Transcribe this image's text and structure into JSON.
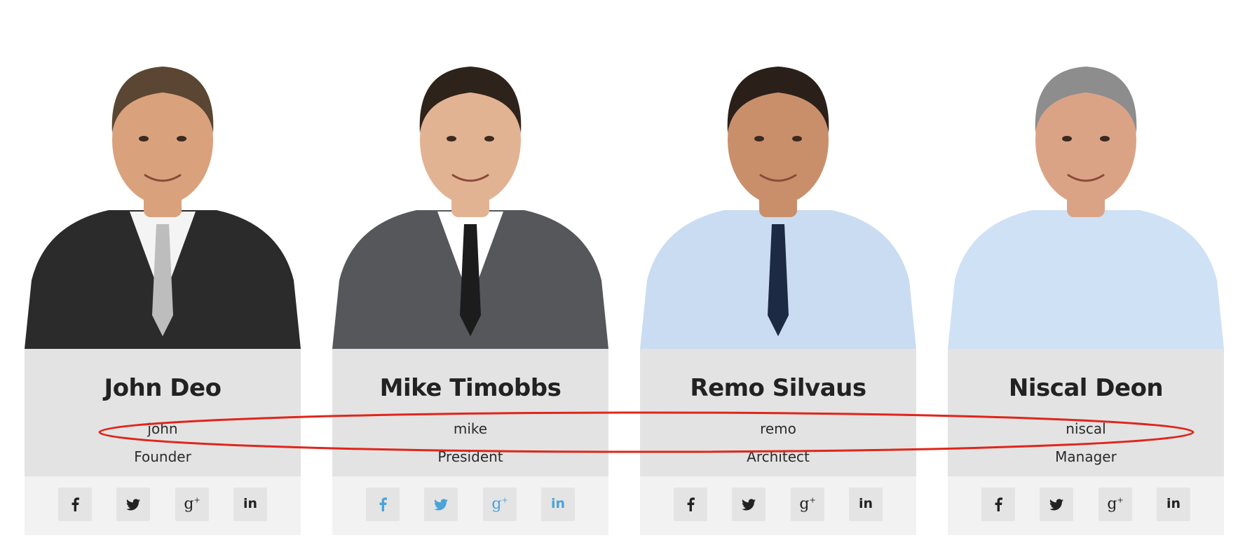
{
  "members": [
    {
      "name": "John Deo",
      "username": "john",
      "role": "Founder",
      "photo_icon": "person-photo",
      "suit": "#2b2b2b",
      "shirt": "#f4f4f4",
      "tie": "#bdbdbd",
      "hair": "#5a4632",
      "skin": "#d9a27c",
      "social_color": "#222222",
      "social": [
        "facebook-icon",
        "twitter-icon",
        "google-plus-icon",
        "linkedin-icon"
      ]
    },
    {
      "name": "Mike Timobbs",
      "username": "mike",
      "role": "President",
      "photo_icon": "person-photo",
      "suit": "#55575a",
      "shirt": "#ffffff",
      "tie": "#1c1c1c",
      "hair": "#2e231b",
      "skin": "#e2b393",
      "social_color": "#4aa3d9",
      "social": [
        "facebook-icon",
        "twitter-icon",
        "google-plus-icon",
        "linkedin-icon"
      ]
    },
    {
      "name": "Remo Silvaus",
      "username": "remo",
      "role": "Architect",
      "photo_icon": "person-photo",
      "suit": "#c9dcf2",
      "shirt": "#c9dcf2",
      "tie": "#1d2a44",
      "hair": "#2a2019",
      "skin": "#c98f6b",
      "social_color": "#222222",
      "social": [
        "facebook-icon",
        "twitter-icon",
        "google-plus-icon",
        "linkedin-icon"
      ]
    },
    {
      "name": "Niscal Deon",
      "username": "niscal",
      "role": "Manager",
      "photo_icon": "person-photo",
      "suit": "#cfe1f5",
      "shirt": "#cfe1f5",
      "tie": "",
      "hair": "#8d8d8d",
      "skin": "#dba386",
      "social_color": "#222222",
      "social": [
        "facebook-icon",
        "twitter-icon",
        "google-plus-icon",
        "linkedin-icon"
      ]
    }
  ],
  "annotation": {
    "shape": "ellipse",
    "color": "#e0251b"
  }
}
